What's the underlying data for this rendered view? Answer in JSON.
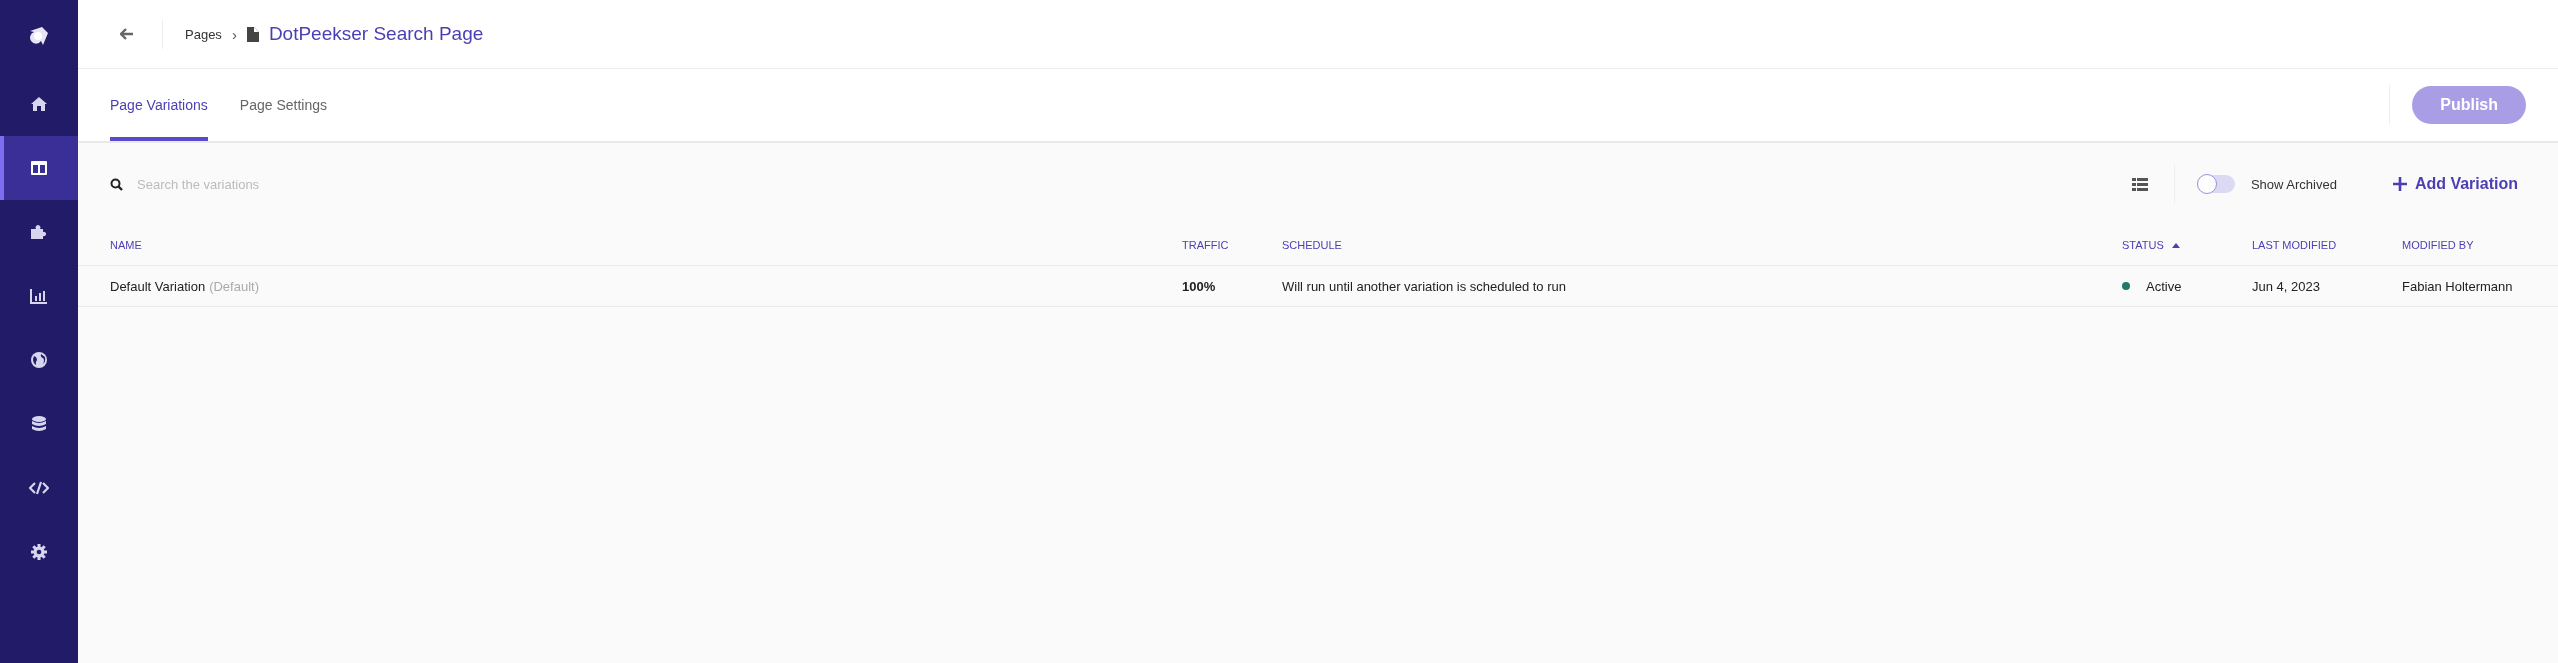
{
  "sidebar": {
    "items": [
      {
        "selected": false
      },
      {
        "selected": true
      },
      {
        "selected": false
      },
      {
        "selected": false
      },
      {
        "selected": false
      },
      {
        "selected": false
      },
      {
        "selected": false
      },
      {
        "selected": false
      }
    ]
  },
  "breadcrumb": {
    "parent": "Pages",
    "separator": "›",
    "current": "DotPeekser Search Page"
  },
  "tabs": [
    {
      "label": "Page Variations",
      "selected": true
    },
    {
      "label": "Page Settings",
      "selected": false
    }
  ],
  "publish_button": {
    "label": "Publish",
    "disabled": true
  },
  "search": {
    "placeholder": "Search the variations"
  },
  "show_archived": {
    "label": "Show Archived",
    "on": false
  },
  "add_button": {
    "label": "Add Variation"
  },
  "table": {
    "columns": [
      {
        "label": "NAME",
        "sorted": false
      },
      {
        "label": "TRAFFIC",
        "sorted": false
      },
      {
        "label": "SCHEDULE",
        "sorted": false
      },
      {
        "label": "STATUS",
        "sorted": true
      },
      {
        "label": "LAST MODIFIED",
        "sorted": false
      },
      {
        "label": "MODIFIED BY",
        "sorted": false
      }
    ],
    "rows": [
      {
        "name": "Default Variation",
        "tag": "(Default)",
        "traffic": "100%",
        "schedule": "Will run until another variation is scheduled to run",
        "status": {
          "label": "Active",
          "color": "#1f7a6e"
        },
        "last_modified": "Jun 4, 2023",
        "modified_by": "Fabian Holtermann"
      }
    ]
  }
}
